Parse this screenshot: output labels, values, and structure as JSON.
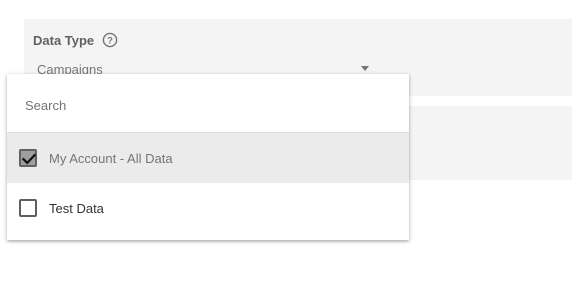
{
  "field": {
    "label": "Data Type",
    "help_icon": "help-circle-icon",
    "selected_value": "Campaigns"
  },
  "dropdown": {
    "search_placeholder": "Search",
    "options": [
      {
        "label": "My Account - All Data",
        "checked": true
      },
      {
        "label": "Test Data",
        "checked": false
      }
    ]
  },
  "colors": {
    "panel_bg": "#f4f4f4",
    "selected_row_bg": "#ebebeb",
    "checkbox_checked_fill": "#9e9e9e"
  }
}
